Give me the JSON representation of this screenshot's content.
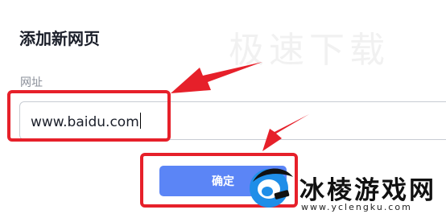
{
  "dialog": {
    "title": "添加新网页",
    "url_label": "网址",
    "url_value": "www.baidu.com",
    "confirm_label": "确定"
  },
  "watermark": {
    "top_text": "极速下载",
    "brand_name": "冰棱游戏网",
    "brand_url": "www.yclengku.com"
  },
  "colors": {
    "primary_button": "#5b85f6",
    "annotation_red": "#e6202a",
    "logo_blue": "#1f8ee8"
  }
}
